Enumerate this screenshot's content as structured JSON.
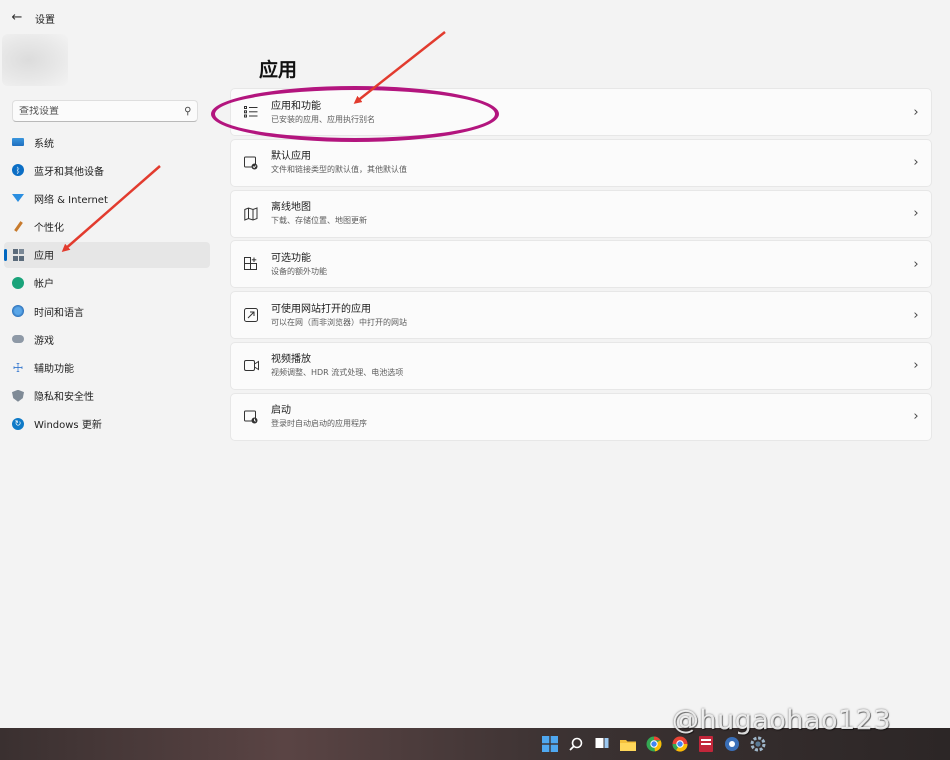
{
  "window": {
    "title": "设置"
  },
  "search": {
    "placeholder": "查找设置"
  },
  "nav": {
    "items": [
      {
        "label": "系统"
      },
      {
        "label": "蓝牙和其他设备"
      },
      {
        "label": "网络 & Internet"
      },
      {
        "label": "个性化"
      },
      {
        "label": "应用"
      },
      {
        "label": "帐户"
      },
      {
        "label": "时间和语言"
      },
      {
        "label": "游戏"
      },
      {
        "label": "辅助功能"
      },
      {
        "label": "隐私和安全性"
      },
      {
        "label": "Windows 更新"
      }
    ]
  },
  "page": {
    "title": "应用"
  },
  "cards": [
    {
      "title": "应用和功能",
      "subtitle": "已安装的应用、应用执行别名",
      "icon": "list-icon"
    },
    {
      "title": "默认应用",
      "subtitle": "文件和链接类型的默认值，其他默认值",
      "icon": "default-apps-icon"
    },
    {
      "title": "离线地图",
      "subtitle": "下载、存储位置、地图更新",
      "icon": "map-icon"
    },
    {
      "title": "可选功能",
      "subtitle": "设备的额外功能",
      "icon": "add-feature-icon"
    },
    {
      "title": "可使用网站打开的应用",
      "subtitle": "可以在网（而非浏览器）中打开的网站",
      "icon": "web-apps-icon"
    },
    {
      "title": "视频播放",
      "subtitle": "视频调整、HDR 流式处理、电池选项",
      "icon": "video-icon"
    },
    {
      "title": "启动",
      "subtitle": "登录时自动启动的应用程序",
      "icon": "startup-icon"
    }
  ],
  "watermark": {
    "text": "@hugaohao123"
  },
  "colors": {
    "accent": "#0067c0",
    "annotation_ellipse": "#b3157e",
    "annotation_arrow": "#e23b2e"
  }
}
